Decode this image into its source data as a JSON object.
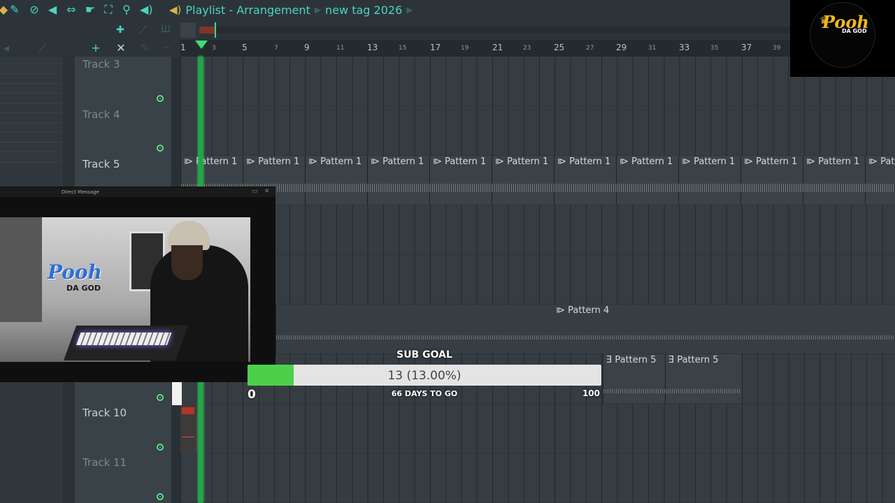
{
  "toolbar": {
    "icons": [
      "magnet-icon",
      "paint-icon",
      "mute-icon",
      "speaker-icon",
      "resize-icon",
      "select-icon",
      "zoom-icon",
      "play-audio-icon"
    ],
    "title_main": "Playlist - Arrangement",
    "title_sub": "new tag 2026"
  },
  "ruler": {
    "major": [
      "1",
      "5",
      "9",
      "13",
      "17",
      "21",
      "25",
      "29",
      "33",
      "37"
    ],
    "minor": [
      "3",
      "7",
      "11",
      "15",
      "19",
      "23",
      "27",
      "31",
      "35",
      "39"
    ]
  },
  "tracks": {
    "t3": "Track 3",
    "t4": "Track 4",
    "t5": "Track 5",
    "t10": "Track 10",
    "t11": "Track 11"
  },
  "clips": {
    "pattern1": "Pattern 1",
    "pattern4": "Pattern 4",
    "pattern5": "Pattern 5"
  },
  "webcam": {
    "window_title": "Direct Message",
    "logo_main": "Pooh",
    "logo_sub": "DA GOD"
  },
  "sub_goal": {
    "title": "SUB GOAL",
    "progress_text": "13 (13.00%)",
    "progress_fraction": 0.13,
    "min": "0",
    "max": "100",
    "days_left": "66 DAYS TO GO",
    "fill_color": "#4cd04a"
  },
  "brand_logo": {
    "main": "Pooh",
    "sub": "DA GOD",
    "color": "#f2b81d"
  },
  "colors": {
    "accent": "#4cd3c2",
    "playhead": "#1fa845"
  }
}
